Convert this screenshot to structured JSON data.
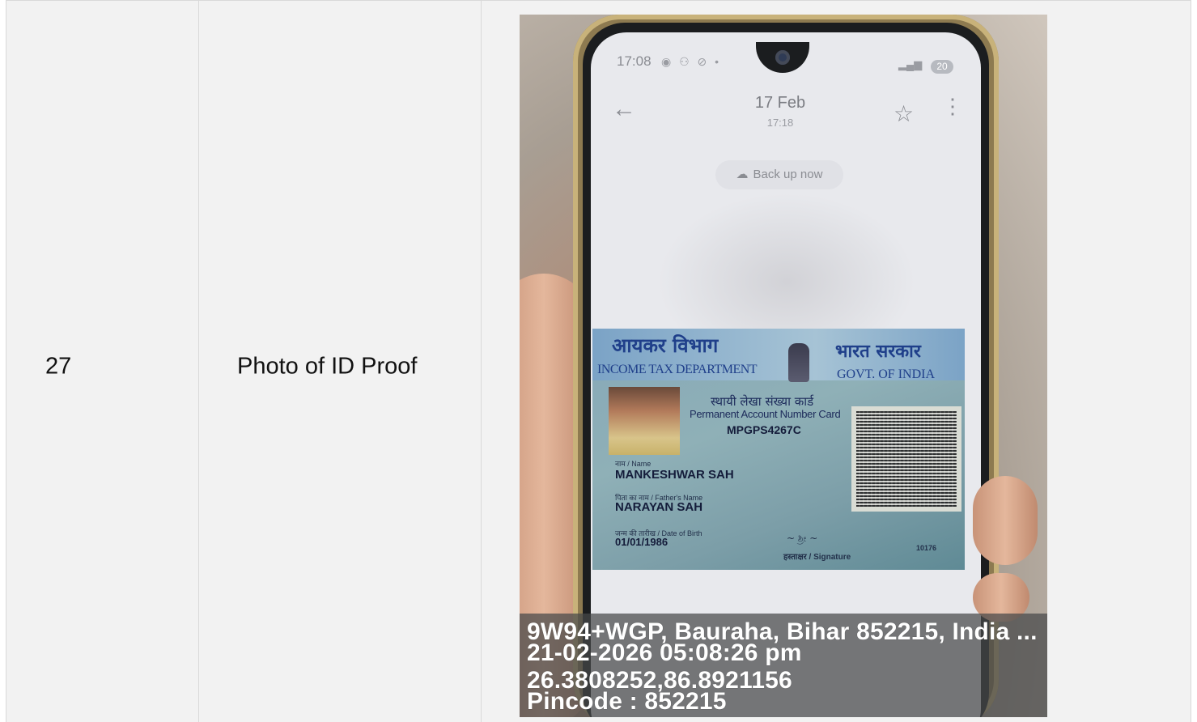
{
  "row": {
    "serial": "27",
    "document_label": "Photo of ID Proof"
  },
  "photo": {
    "phone_screen": {
      "status_time": "17:08",
      "battery": "20",
      "date_title": "17 Feb",
      "time_sub": "17:18",
      "backup_label": "Back up now"
    },
    "pan_card": {
      "dept_hindi": "आयकर विभाग",
      "dept_english": "INCOME TAX DEPARTMENT",
      "country_hindi": "भारत सरकार",
      "country_english": "GOVT. OF INDIA",
      "card_title_hindi": "स्थायी लेखा संख्या कार्ड",
      "card_title_english": "Permanent Account Number Card",
      "pan_number": "MPGPS4267C",
      "name_label": "नाम / Name",
      "name": "MANKESHWAR SAH",
      "father_label": "पिता का नाम / Father's Name",
      "father_name": "NARAYAN SAH",
      "dob_label": "जन्म की तारीख / Date of Birth",
      "dob": "01/01/1986",
      "signature_label": "हस्ताक्षर / Signature",
      "card_code": "10176"
    },
    "geotag": {
      "address": "9W94+WGP, Bauraha, Bihar 852215, India ...",
      "datetime": "21-02-2026 05:08:26 pm",
      "coordinates": "26.3808252,86.8921156",
      "pincode": "Pincode : 852215"
    }
  }
}
